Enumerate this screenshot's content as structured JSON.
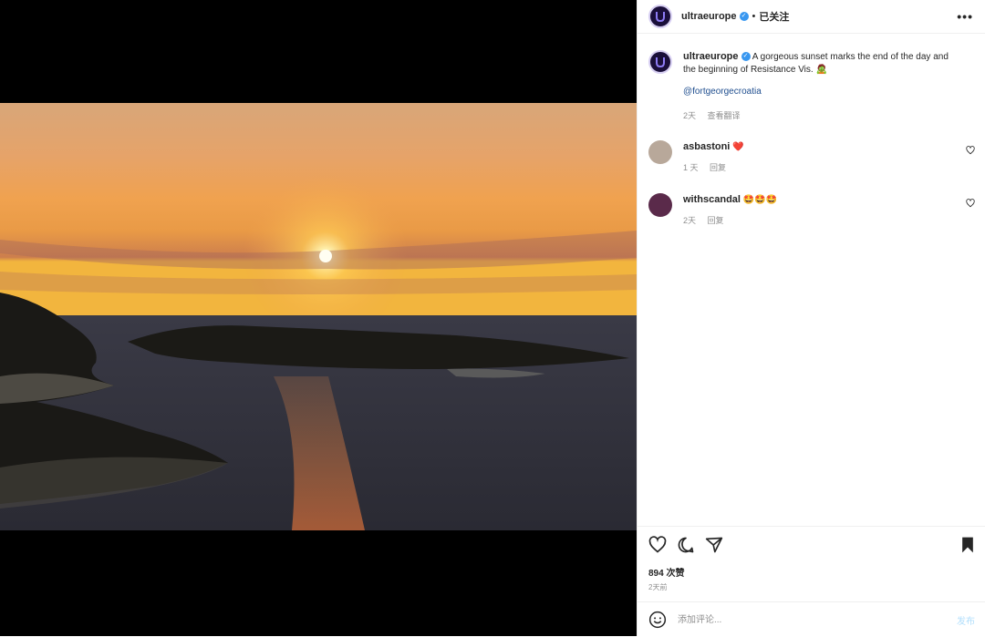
{
  "post": {
    "username": "ultraeurope",
    "follow_label": "已关注",
    "more_label": "•••",
    "caption": "A gorgeous sunset marks the end of the day and the beginning of Resistance Vis. 🧟",
    "mention": "@fortgeorgecroatia",
    "caption_time": "2天",
    "see_translation": "查看翻译",
    "likes": "894 次赞",
    "posted_ago": "2天前"
  },
  "comments": [
    {
      "username": "asbastoni",
      "text": "❤️",
      "time": "1 天",
      "reply": "回复"
    },
    {
      "username": "withscandal",
      "text": "🤩🤩🤩",
      "time": "2天",
      "reply": "回复"
    }
  ],
  "composer": {
    "placeholder": "添加评论...",
    "post_label": "发布"
  },
  "colors": {
    "verified": "#3897f0",
    "link": "#1f4e8f",
    "post_disabled": "#b2dffc",
    "brand_avatar": "#1a0f3a"
  },
  "icons": [
    "verified-badge-icon",
    "more-icon",
    "heart-icon",
    "comment-icon",
    "share-icon",
    "bookmark-icon",
    "emoji-icon",
    "ultra-logo-icon"
  ]
}
